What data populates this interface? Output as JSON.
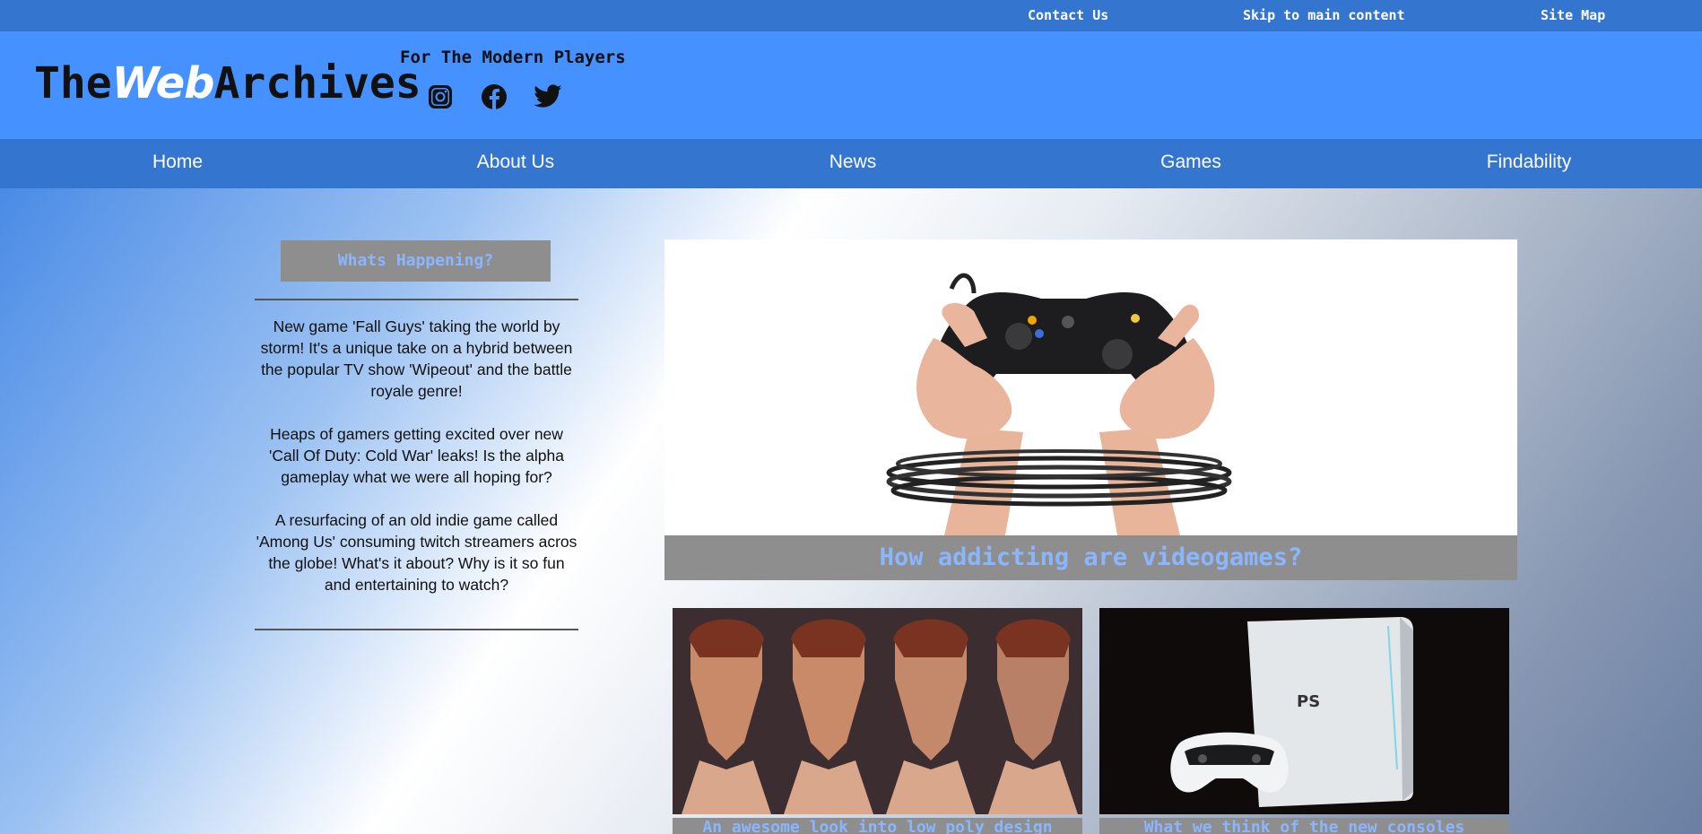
{
  "utility": {
    "contact_label": "Contact Us",
    "skip_label": "Skip to main content",
    "sitemap_label": "Site Map"
  },
  "header": {
    "logo_left": "The",
    "logo_accent": "Web",
    "logo_right": "Archives",
    "tagline": "For The Modern Players",
    "social_icons": [
      "instagram-icon",
      "facebook-icon",
      "twitter-icon"
    ]
  },
  "nav": {
    "items": [
      {
        "label": "Home"
      },
      {
        "label": "About Us"
      },
      {
        "label": "News"
      },
      {
        "label": "Games"
      },
      {
        "label": "Findability"
      }
    ]
  },
  "sidebar": {
    "title": "Whats Happening?",
    "items": [
      {
        "text": "New game 'Fall Guys' taking the world by storm! It's a unique take on a hybrid between the popular TV show 'Wipeout' and the battle royale genre!"
      },
      {
        "text": "Heaps of gamers getting excited over new 'Call Of Duty: Cold War' leaks! Is the alpha gameplay what we were all hoping for?"
      },
      {
        "text": "A resurfacing of an old indie game called 'Among Us' consuming twitch streamers acros the globe! What's it about? Why is it so fun and entertaining to watch?"
      }
    ]
  },
  "featured": {
    "caption": "How addicting are videogames?"
  },
  "cards": [
    {
      "caption": "An awesome look into low poly design"
    },
    {
      "caption": "What we think of the new consoles"
    }
  ],
  "colors": {
    "utility_bar": "#3475cf",
    "header": "#4591ff",
    "nav": "#3475cf",
    "caption_bg": "#8e8e8e",
    "caption_text": "#8ab6ff"
  }
}
